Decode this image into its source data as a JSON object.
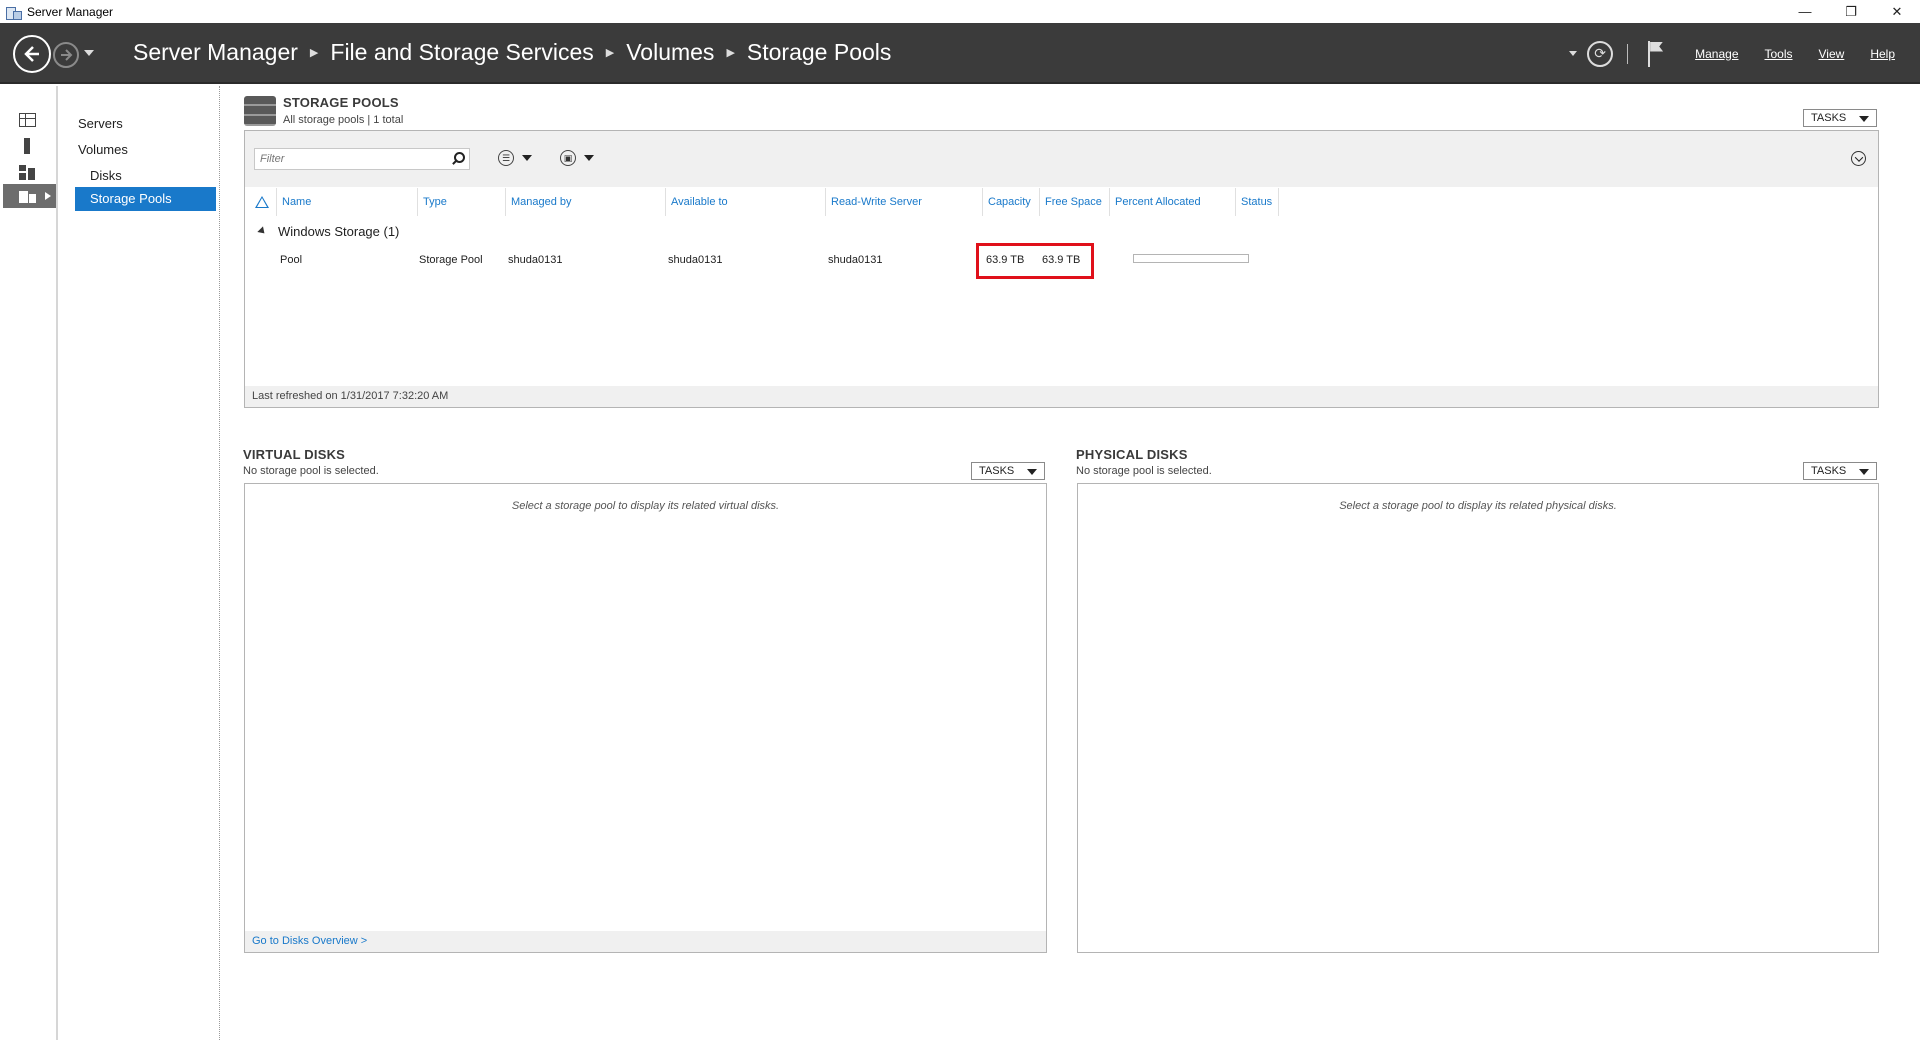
{
  "window": {
    "title": "Server Manager",
    "minimize": "—",
    "restore": "❐",
    "close": "✕"
  },
  "header": {
    "breadcrumb": [
      "Server Manager",
      "File and Storage Services",
      "Volumes",
      "Storage Pools"
    ],
    "menu": [
      "Manage",
      "Tools",
      "View",
      "Help"
    ],
    "refresh_glyph": "⟳"
  },
  "iconstrip": [
    "dashboard-icon",
    "server-icon",
    "roles-icon",
    "storage-icon"
  ],
  "subnav": {
    "items": [
      "Servers",
      "Volumes",
      "Disks",
      "Storage Pools"
    ],
    "selected": "Storage Pools"
  },
  "storage_pools": {
    "title": "STORAGE POOLS",
    "subtitle": "All storage pools | 1 total",
    "tasks": "TASKS",
    "filter_placeholder": "Filter",
    "list_glyph": "☰",
    "save_glyph": "▣",
    "columns": [
      "Name",
      "Type",
      "Managed by",
      "Available to",
      "Read-Write Server",
      "Capacity",
      "Free Space",
      "Percent Allocated",
      "Status"
    ],
    "group": "Windows Storage (1)",
    "rows": [
      {
        "name": "Pool",
        "type": "Storage Pool",
        "managed_by": "shuda0131",
        "available_to": "shuda0131",
        "rw_server": "shuda0131",
        "capacity": "63.9 TB",
        "free_space": "63.9 TB",
        "percent_allocated": 0,
        "status": ""
      }
    ],
    "last_refreshed": "Last refreshed on 1/31/2017 7:32:20 AM"
  },
  "virtual_disks": {
    "title": "VIRTUAL DISKS",
    "subtitle": "No storage pool is selected.",
    "tasks": "TASKS",
    "empty": "Select a storage pool to display its related virtual disks.",
    "link": "Go to Disks Overview >"
  },
  "physical_disks": {
    "title": "PHYSICAL DISKS",
    "subtitle": "No storage pool is selected.",
    "tasks": "TASKS",
    "empty": "Select a storage pool to display its related physical disks."
  },
  "colors": {
    "header": "#3b3b3b",
    "accent": "#1979ca",
    "highlight": "#e0101a"
  }
}
